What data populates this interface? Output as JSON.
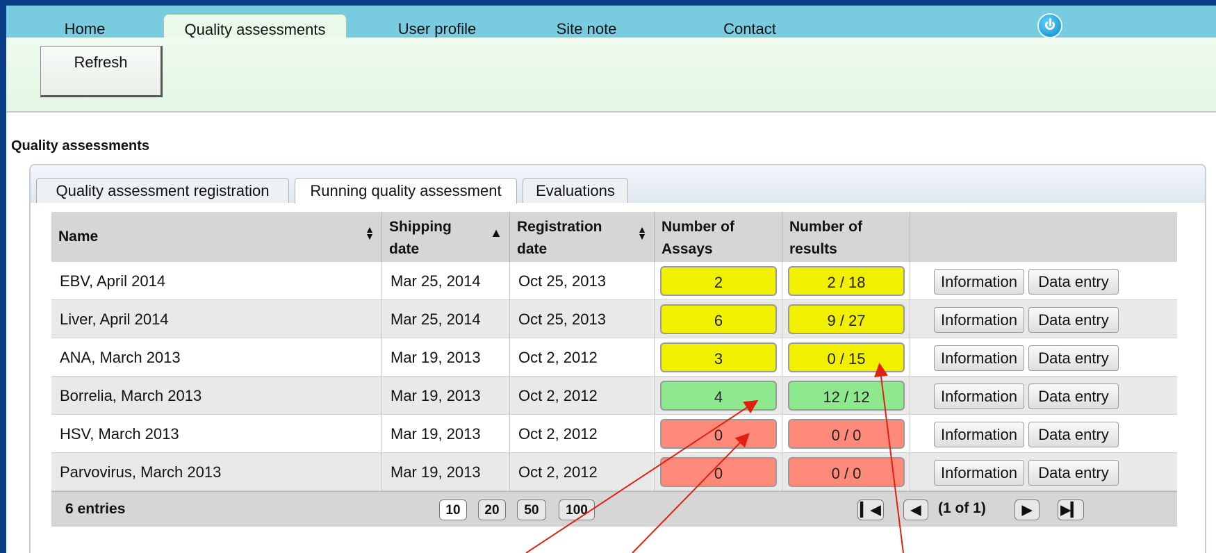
{
  "nav": {
    "items": [
      {
        "label": "Home"
      },
      {
        "label": "Quality assessments"
      },
      {
        "label": "User profile"
      },
      {
        "label": "Site note"
      },
      {
        "label": "Contact"
      }
    ],
    "power_icon": "power-icon"
  },
  "toolbar": {
    "refresh_label": "Refresh"
  },
  "page": {
    "title": "Quality assessments"
  },
  "tabs": [
    {
      "label": "Quality assessment registration"
    },
    {
      "label": "Running quality assessment"
    },
    {
      "label": "Evaluations"
    }
  ],
  "table": {
    "columns": [
      {
        "label": "Name"
      },
      {
        "label": "Shipping date"
      },
      {
        "label": "Registration date"
      },
      {
        "label": "Number of Assays"
      },
      {
        "label": "Number of results"
      },
      {
        "label": ""
      }
    ],
    "rows": [
      {
        "name": "EBV, April 2014",
        "shipping": "Mar 25, 2014",
        "registration": "Oct 25, 2013",
        "assays": "2",
        "results": "2 / 18",
        "status_color": "#f0f000"
      },
      {
        "name": "Liver, April 2014",
        "shipping": "Mar 25, 2014",
        "registration": "Oct 25, 2013",
        "assays": "6",
        "results": "9 / 27",
        "status_color": "#f0f000"
      },
      {
        "name": "ANA, March 2013",
        "shipping": "Mar 19, 2013",
        "registration": "Oct 2, 2012",
        "assays": "3",
        "results": "0 / 15",
        "status_color": "#f0f000"
      },
      {
        "name": "Borrelia, March 2013",
        "shipping": "Mar 19, 2013",
        "registration": "Oct 2, 2012",
        "assays": "4",
        "results": "12 / 12",
        "status_color": "#8ee88e"
      },
      {
        "name": "HSV, March 2013",
        "shipping": "Mar 19, 2013",
        "registration": "Oct 2, 2012",
        "assays": "0",
        "results": "0 / 0",
        "status_color": "#ff8a7a"
      },
      {
        "name": "Parvovirus, March 2013",
        "shipping": "Mar 19, 2013",
        "registration": "Oct 2, 2012",
        "assays": "0",
        "results": "0 / 0",
        "status_color": "#ff8a7a"
      }
    ],
    "actions": {
      "information_label": "Information",
      "data_entry_label": "Data entry"
    }
  },
  "footer": {
    "entries": "6 entries",
    "page_sizes": [
      "10",
      "20",
      "50",
      "100"
    ],
    "selected_page_size": "10",
    "page_info": "(1 of 1)"
  },
  "colors": {
    "nav_bg": "#79cce0",
    "frame": "#0a3f88",
    "annotation_arrow": "#e02010"
  }
}
